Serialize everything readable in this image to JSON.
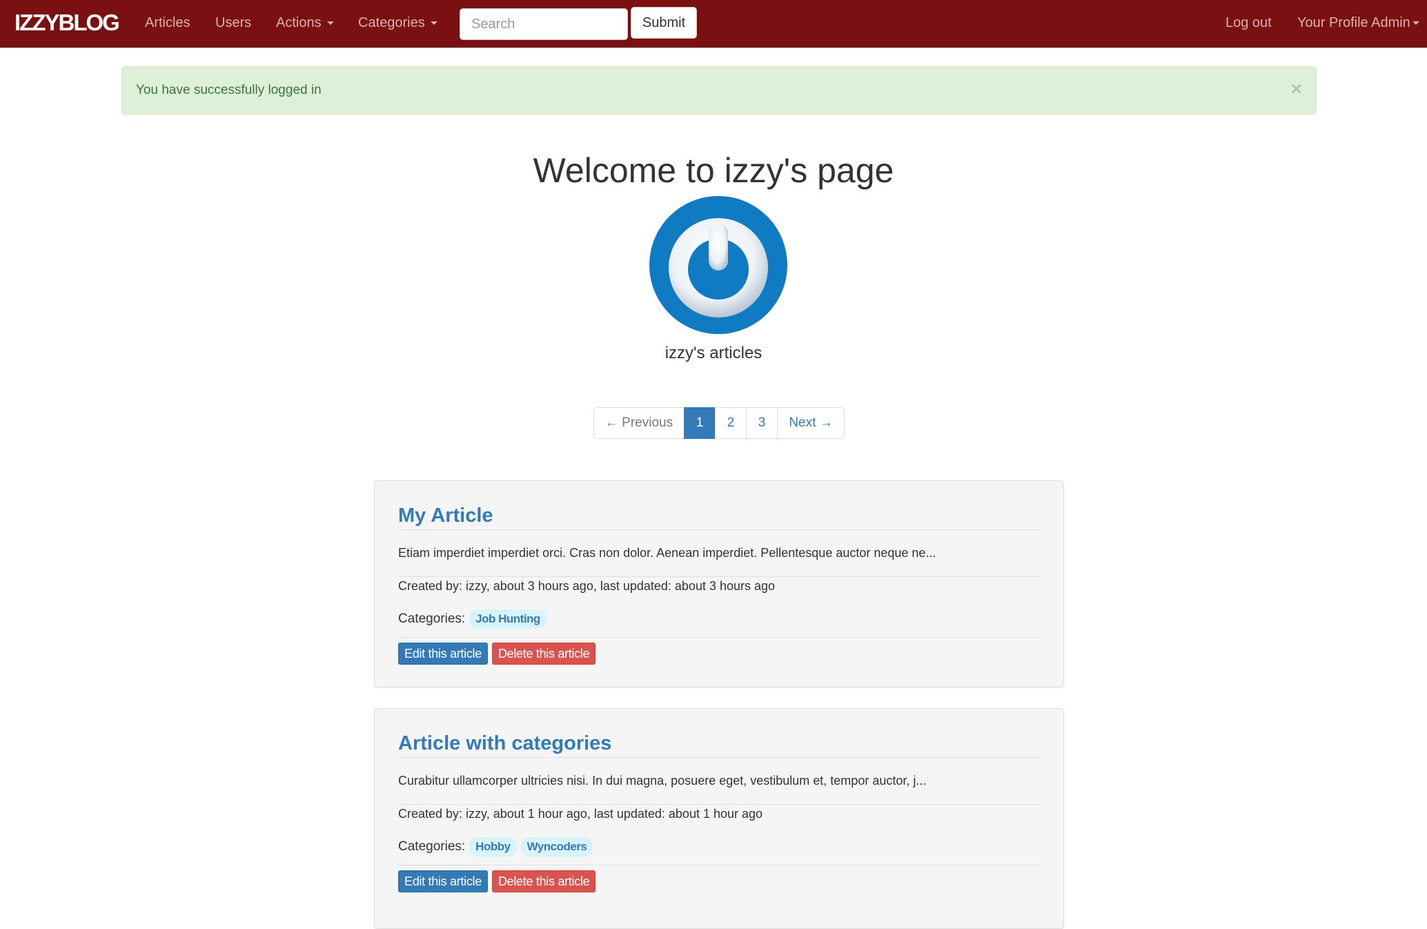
{
  "navbar": {
    "brand": "IZZYBLOG",
    "links": {
      "articles": "Articles",
      "users": "Users",
      "actions": "Actions",
      "categories": "Categories"
    },
    "search": {
      "placeholder": "Search",
      "value": ""
    },
    "submit_label": "Submit",
    "logout": "Log out",
    "profile": "Your Profile Admin",
    "color": "#7b1013"
  },
  "alert": {
    "message": "You have successfully logged in",
    "close_symbol": "×"
  },
  "header": {
    "title": "Welcome to izzy's page",
    "subtitle": "izzy's articles",
    "avatar_icon": "power-logo-avatar"
  },
  "pagination": {
    "previous": "← Previous",
    "pages": [
      "1",
      "2",
      "3"
    ],
    "current": "1",
    "next": "Next →"
  },
  "articles": [
    {
      "title": "My Article",
      "excerpt": "Etiam imperdiet imperdiet orci. Cras non dolor. Aenean imperdiet. Pellentesque auctor neque ne...",
      "meta": "Created by: izzy, about 3 hours ago, last updated: about 3 hours ago",
      "categories_label": "Categories:",
      "categories": [
        "Job Hunting"
      ],
      "edit_label": "Edit this article",
      "delete_label": "Delete this article"
    },
    {
      "title": "Article with categories",
      "excerpt": "Curabitur ullamcorper ultricies nisi. In dui magna, posuere eget, vestibulum et, tempor auctor, j...",
      "meta": "Created by: izzy, about 1 hour ago, last updated: about 1 hour ago",
      "categories_label": "Categories:",
      "categories": [
        "Hobby",
        "Wyncoders"
      ],
      "edit_label": "Edit this article",
      "delete_label": "Delete this article"
    }
  ]
}
